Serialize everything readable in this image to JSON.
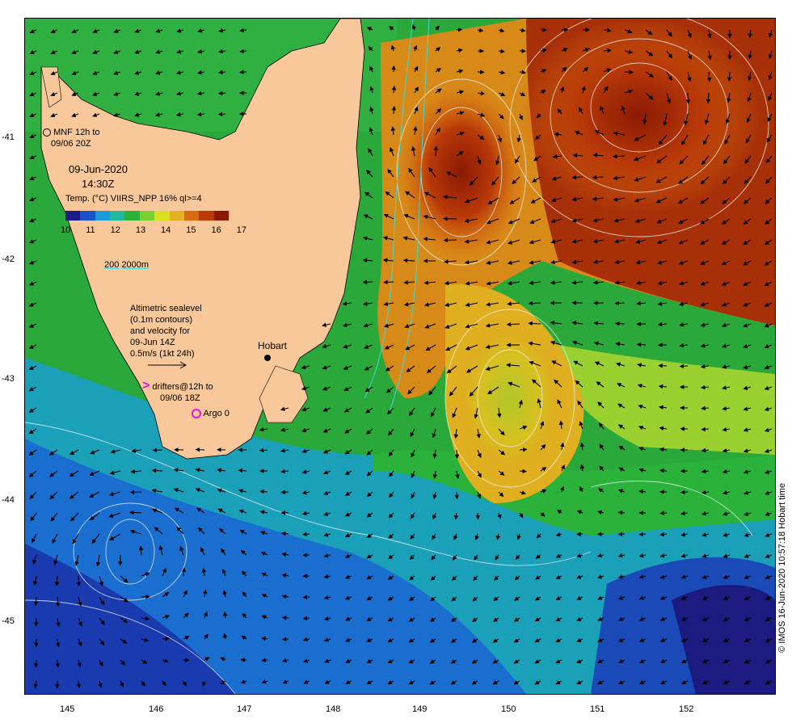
{
  "map": {
    "date": "09-Jun-2020",
    "time": "14:30Z",
    "temp_label": "Temp. (°C) VIIRS_NPP 16% ql>=4",
    "colorbar_ticks": [
      "10",
      "11",
      "12",
      "13",
      "14",
      "15",
      "16",
      "17"
    ],
    "colorbar_colors": [
      "#1c1c88",
      "#1a50c8",
      "#1a9ad8",
      "#22b8a0",
      "#2ab23a",
      "#7ad030",
      "#d8e020",
      "#e8b020",
      "#d86a10",
      "#b83808",
      "#8a1a04"
    ],
    "mnf_marker_label": "MNF 12h to",
    "mnf_marker_time": "09/06 20Z",
    "isobath_200": "200",
    "isobath_2000": "2000m",
    "altimetric_lines": [
      "Altimetric sealevel",
      "(0.1m contours)",
      "and velocity for",
      "09-Jun 14Z",
      "0.5m/s (1kt 24h)"
    ],
    "drifters_label": "drifters@12h to",
    "drifters_time": "09/06 18Z",
    "argo_label": "Argo 0",
    "city_label": "Hobart",
    "credit": "© IMOS 16-Jun-2020 10:57:18 Hobart time",
    "y_ticks": [
      "-41",
      "-42",
      "-43",
      "-44",
      "-45"
    ],
    "x_ticks": [
      "145",
      "146",
      "147",
      "148",
      "149",
      "150",
      "151",
      "152"
    ],
    "colors": {
      "land": "#f8c89a",
      "warm_core": "#a83008",
      "cool_water": "#1a7ad0",
      "mid_water": "#2ab23a"
    }
  }
}
